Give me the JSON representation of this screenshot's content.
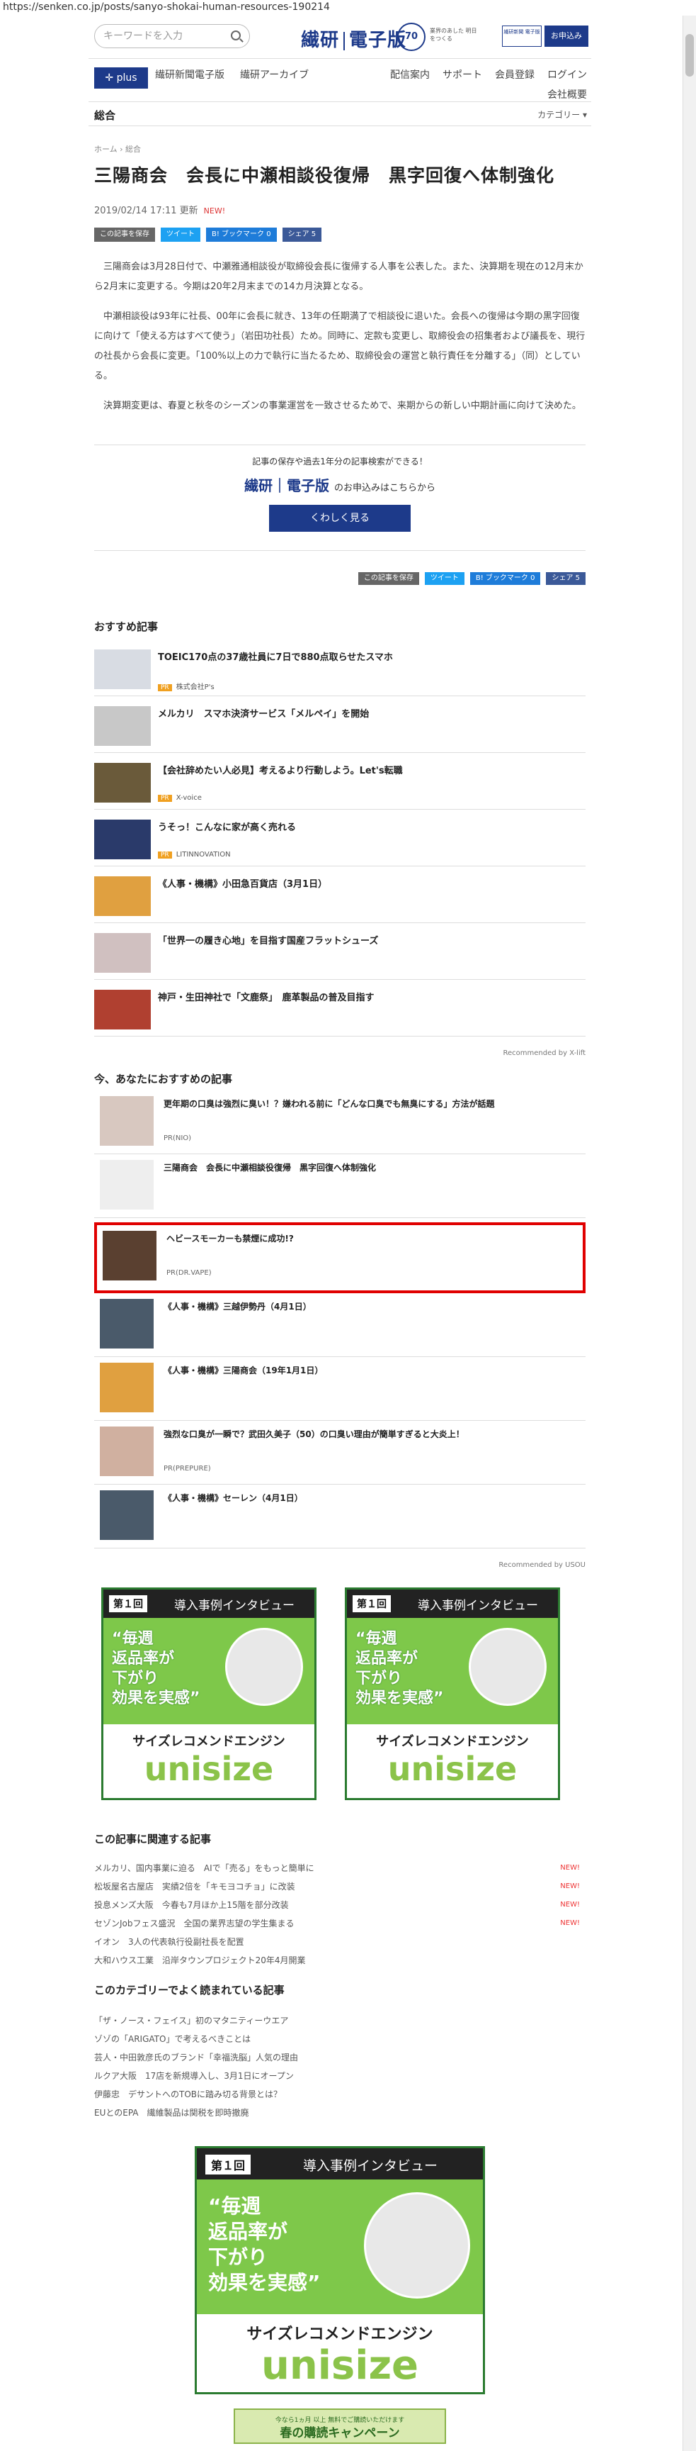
{
  "url": "https://senken.co.jp/posts/sanyo-shokai-human-resources-190214",
  "header": {
    "search_placeholder": "キーワードを入力",
    "logo_left": "繊研",
    "logo_right": "電子版",
    "badge": "70",
    "tagline": "業界のあした 明日をつくる",
    "sub_label": "繊研新聞 電子版",
    "apply": "お申込み"
  },
  "nav": {
    "plus": "plus",
    "items": [
      "繊研新聞電子版",
      "繊研アーカイブ"
    ],
    "right": [
      "配信案内",
      "サポート",
      "会員登録",
      "ログイン"
    ],
    "corp": "会社概要"
  },
  "cat": {
    "title": "総合",
    "menu": "カテゴリー ▾"
  },
  "crumb": "ホーム › 総合",
  "article": {
    "title": "三陽商会　会長に中瀬相談役復帰　黒字回復へ体制強化",
    "date": "2019/02/14 17:11 更新",
    "new": "NEW!",
    "save": "この記事を保存",
    "tweet": "ツイート",
    "hatena": "B! ブックマーク 0",
    "share": "シェア 5",
    "paras": [
      "三陽商会は3月28日付で、中瀬雅通相談役が取締役会長に復帰する人事を公表した。また、決算期を現在の12月末から2月末に変更する。今期は20年2月末までの14カ月決算となる。",
      "中瀬相談役は93年に社長、00年に会長に就き、13年の任期満了で相談役に退いた。会長への復帰は今期の黒字回復に向けて「使える方はすべて使う」（岩田功社長）ため。同時に、定款も変更し、取締役会の招集者および議長を、現行の社長から会長に変更。「100%以上の力で執行に当たるため、取締役会の運営と執行責任を分離する」（同）としている。",
      "決算期変更は、春夏と秋冬のシーズンの事業運営を一致させるためで、来期からの新しい中期計画に向けて決めた。"
    ]
  },
  "cta": {
    "line1": "記事の保存や過去1年分の記事検索ができる！",
    "logo": "繊研｜電子版",
    "suffix": "のお申込みはこちらから",
    "button": "くわしく見る"
  },
  "rec": {
    "title": "おすすめ記事",
    "items": [
      {
        "title": "TOEIC170点の37歳社員に7日で880点取らせたスマホ",
        "pr": "株式会社P's"
      },
      {
        "title": "メルカリ　スマホ決済サービス「メルペイ」を開始",
        "pr": ""
      },
      {
        "title": "【会社辞めたい人必見】考えるより行動しよう。Let's転職",
        "pr": "X-voice"
      },
      {
        "title": "うそっ！こんなに家が高く売れる",
        "pr": "LITINNOVATION"
      },
      {
        "title": "《人事・機構》小田急百貨店（3月1日）",
        "pr": ""
      },
      {
        "title": "「世界一の履き心地」を目指す国産フラットシューズ",
        "pr": ""
      },
      {
        "title": "神戸・生田神社で「文鹿祭」　鹿革製品の普及目指す",
        "pr": ""
      }
    ],
    "by": "Recommended by X-lift"
  },
  "now": {
    "title": "今、あなたにおすすめの記事",
    "items": [
      {
        "title": "更年期の口臭は強烈に臭い！？嫌われる前に「どんな口臭でも無臭にする」方法が話題",
        "pr": "PR(NIO)"
      },
      {
        "title": "三陽商会　会長に中瀬相談役復帰　黒字回復へ体制強化",
        "pr": ""
      },
      {
        "title": "ヘビースモーカーも禁煙に成功!?",
        "pr": "PR(DR.VAPE)"
      },
      {
        "title": "《人事・機構》三越伊勢丹（4月1日）",
        "pr": ""
      },
      {
        "title": "《人事・機構》三陽商会（19年1月1日）",
        "pr": ""
      },
      {
        "title": "強烈な口臭が一瞬で？武田久美子（50）の口臭い理由が簡単すぎると大炎上！",
        "pr": "PR(PREPURE)"
      },
      {
        "title": "《人事・機構》セーレン（4月1日）",
        "pr": ""
      }
    ],
    "by": "Recommended by USOU"
  },
  "ad": {
    "num": "第１回",
    "head": "導入事例インタビュー",
    "quote": "“毎週\n返品率が\n下がり\n効果を実感”",
    "engine": "サイズレコメンドエンジン",
    "brand": "unisize"
  },
  "related": {
    "title": "この記事に関連する記事",
    "items": [
      "メルカリ、国内事業に迫る　AIで「売る」をもっと簡単に",
      "松坂屋名古屋店　実績2倍を「キモヨコチョ」に改装",
      "投息メンズ大阪　今春も7月ほか上15階を部分改装",
      "セゾンJobフェス盛況　全国の業界志望の学生集まる",
      "イオン　3人の代表執行役副社長を配置",
      "大和ハウス工業　沿岸タウンプロジェクト20年4月開業"
    ],
    "new": "NEW!"
  },
  "popular": {
    "title": "このカテゴリーでよく読まれている記事",
    "items": [
      "「ザ・ノース・フェイス」初のマタニティーウエア",
      "ゾゾの「ARIGATO」で考えるべきことは",
      "芸人・中田敦彦氏のブランド「幸福洗脳」人気の理由",
      "ルクア大阪　17店を新規導入し、3月1日にオープン",
      "伊藤忠　デサントへのTOBに踏み切る背景とは？",
      "EUとのEPA　繊維製品は関税を即時撤廃"
    ]
  },
  "spring": {
    "line1": "今なら1ヵ月 以上 無料でご購読いただけます",
    "line2": "春の購読キャンペーン"
  }
}
